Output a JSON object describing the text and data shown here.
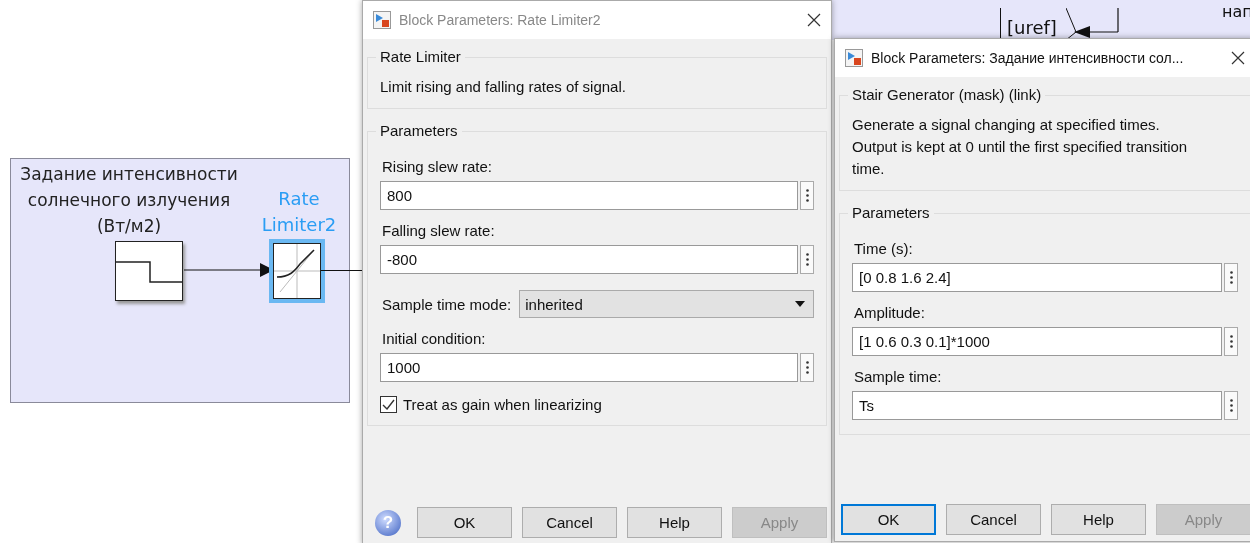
{
  "canvas": {
    "subsystem": {
      "label_lines": [
        "Задание интенсивности",
        "солнечного излучения",
        "(Вт/м2)"
      ]
    },
    "rate_limiter_block": {
      "label_lines": [
        "Rate",
        "Limiter2"
      ],
      "selected": true
    },
    "goto_tag": "[uref]",
    "cut_label": "нап"
  },
  "dialogs": [
    {
      "title": "Block Parameters: Rate Limiter2",
      "group_title": "Rate Limiter",
      "description_lines": [
        "Limit rising and falling rates of signal."
      ],
      "parameters_title": "Parameters",
      "help_glyph": "?",
      "parameters": [
        {
          "kind": "text",
          "label": "Rising slew rate:",
          "value": "800"
        },
        {
          "kind": "text",
          "label": "Falling slew rate:",
          "value": "-800"
        },
        {
          "kind": "dropdown",
          "label": "Sample time mode:",
          "value": "inherited"
        },
        {
          "kind": "text",
          "label": "Initial condition:",
          "value": "1000"
        },
        {
          "kind": "checkbox",
          "label": "Treat as gain when linearizing",
          "checked": true
        }
      ],
      "buttons": [
        {
          "label": "OK",
          "focused": false,
          "disabled": false
        },
        {
          "label": "Cancel",
          "focused": false,
          "disabled": false
        },
        {
          "label": "Help",
          "focused": false,
          "disabled": false
        },
        {
          "label": "Apply",
          "focused": false,
          "disabled": true
        }
      ]
    },
    {
      "title": "Block Parameters: Задание интенсивности сол...",
      "group_title": "Stair Generator (mask) (link)",
      "description_lines": [
        "Generate a signal changing at specified times.",
        "Output is kept at 0 until the first specified transition",
        "time."
      ],
      "parameters_title": "Parameters",
      "parameters": [
        {
          "kind": "text",
          "label": "Time (s):",
          "value": "[0 0.8 1.6 2.4]"
        },
        {
          "kind": "text",
          "label": "Amplitude:",
          "value": "[1 0.6 0.3 0.1]*1000"
        },
        {
          "kind": "text",
          "label": "Sample time:",
          "value": "Ts"
        }
      ],
      "buttons": [
        {
          "label": "OK",
          "focused": true,
          "disabled": false
        },
        {
          "label": "Cancel",
          "focused": false,
          "disabled": false
        },
        {
          "label": "Help",
          "focused": false,
          "disabled": false
        },
        {
          "label": "Apply",
          "focused": false,
          "disabled": true
        }
      ]
    }
  ]
}
